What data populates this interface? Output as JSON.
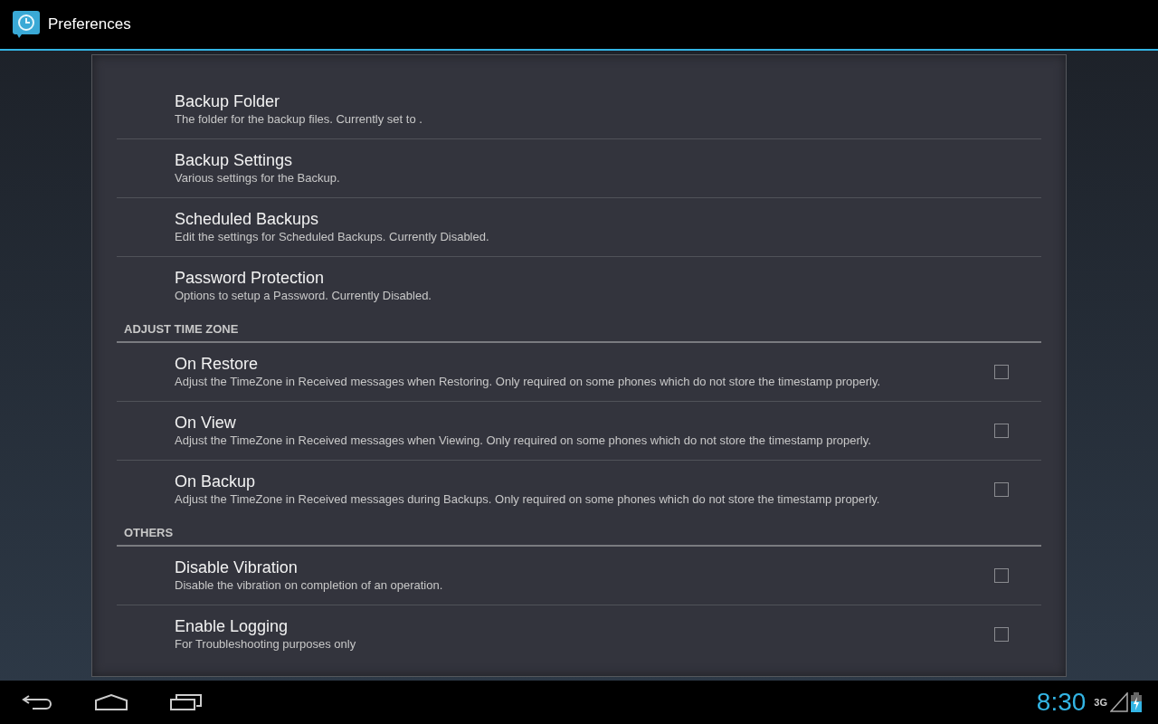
{
  "action_bar": {
    "title": "Preferences"
  },
  "sections": [
    {
      "items": [
        {
          "kind": "link",
          "title": "Backup Folder",
          "summary": "The folder for the backup files. Currently set to ."
        },
        {
          "kind": "link",
          "title": "Backup Settings",
          "summary": "Various settings for the Backup."
        },
        {
          "kind": "link",
          "title": "Scheduled Backups",
          "summary": "Edit the settings for Scheduled Backups. Currently Disabled."
        },
        {
          "kind": "link",
          "title": "Password Protection",
          "summary": "Options to setup a Password. Currently Disabled."
        }
      ]
    },
    {
      "header": "ADJUST TIME ZONE",
      "items": [
        {
          "kind": "checkbox",
          "title": "On Restore",
          "summary": "Adjust the TimeZone in Received messages when Restoring. Only required on some phones which do not store the timestamp properly.",
          "checked": false
        },
        {
          "kind": "checkbox",
          "title": "On View",
          "summary": "Adjust the TimeZone in Received messages when Viewing. Only required on some phones which do not store the timestamp properly.",
          "checked": false
        },
        {
          "kind": "checkbox",
          "title": "On Backup",
          "summary": "Adjust the TimeZone in Received messages during Backups. Only required on some phones which do not store the timestamp properly.",
          "checked": false
        }
      ]
    },
    {
      "header": "OTHERS",
      "items": [
        {
          "kind": "checkbox",
          "title": "Disable Vibration",
          "summary": "Disable the vibration on completion of an operation.",
          "checked": false
        },
        {
          "kind": "checkbox",
          "title": "Enable Logging",
          "summary": "For Troubleshooting purposes only",
          "checked": false
        }
      ]
    }
  ],
  "system_bar": {
    "clock": "8:30",
    "network": "3G"
  }
}
